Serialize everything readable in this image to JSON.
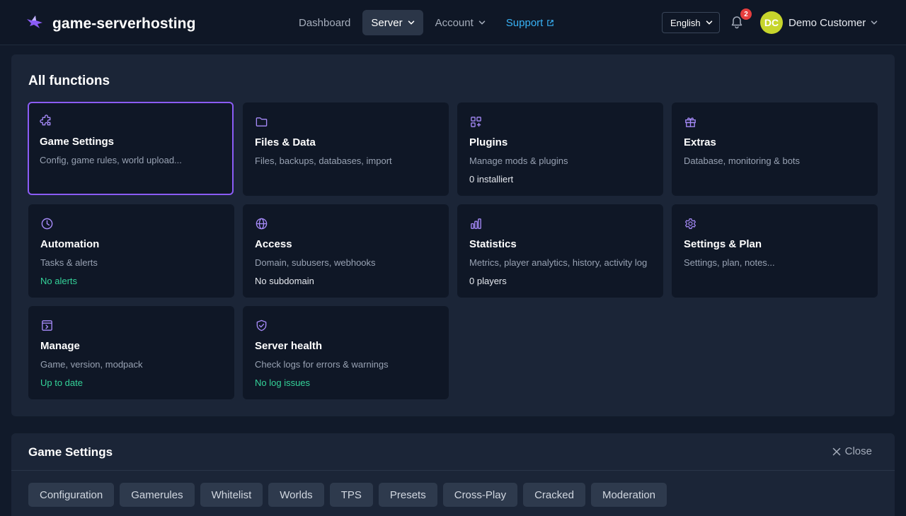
{
  "header": {
    "brand": "game-serverhosting",
    "nav": [
      {
        "label": "Dashboard"
      },
      {
        "label": "Server"
      },
      {
        "label": "Account"
      },
      {
        "label": "Support"
      }
    ],
    "language": "English",
    "notification_count": "2",
    "user_initials": "DC",
    "user_name": "Demo Customer"
  },
  "functions": {
    "title": "All functions",
    "cards": [
      {
        "title": "Game Settings",
        "desc": "Config, game rules, world upload...",
        "status": "",
        "icon": "puzzle-icon"
      },
      {
        "title": "Files & Data",
        "desc": "Files, backups, databases, import",
        "status": "",
        "icon": "folder-icon"
      },
      {
        "title": "Plugins",
        "desc": "Manage mods & plugins",
        "status": "0 installiert",
        "icon": "apps-add-icon"
      },
      {
        "title": "Extras",
        "desc": "Database, monitoring & bots",
        "status": "",
        "icon": "gift-icon"
      },
      {
        "title": "Automation",
        "desc": "Tasks & alerts",
        "status": "No alerts",
        "icon": "clock-icon"
      },
      {
        "title": "Access",
        "desc": "Domain, subusers, webhooks",
        "status": "No subdomain",
        "icon": "globe-icon"
      },
      {
        "title": "Statistics",
        "desc": "Metrics, player analytics, history, activity log",
        "status": "0 players",
        "icon": "bar-chart-icon"
      },
      {
        "title": "Settings & Plan",
        "desc": "Settings, plan, notes...",
        "status": "",
        "icon": "gear-icon"
      },
      {
        "title": "Manage",
        "desc": "Game, version, modpack",
        "status": "Up to date",
        "icon": "terminal-window-icon"
      },
      {
        "title": "Server health",
        "desc": "Check logs for errors & warnings",
        "status": "No log issues",
        "icon": "shield-check-icon"
      }
    ]
  },
  "game_settings": {
    "title": "Game Settings",
    "close_label": "Close",
    "tabs": [
      "Configuration",
      "Gamerules",
      "Whitelist",
      "Worlds",
      "TPS",
      "Presets",
      "Cross-Play",
      "Cracked",
      "Moderation"
    ]
  },
  "colors": {
    "accent": "#8b5cf6",
    "success": "#34d399",
    "link": "#38b2f5",
    "badge": "#e53e3e",
    "avatar": "#c7d52c"
  }
}
